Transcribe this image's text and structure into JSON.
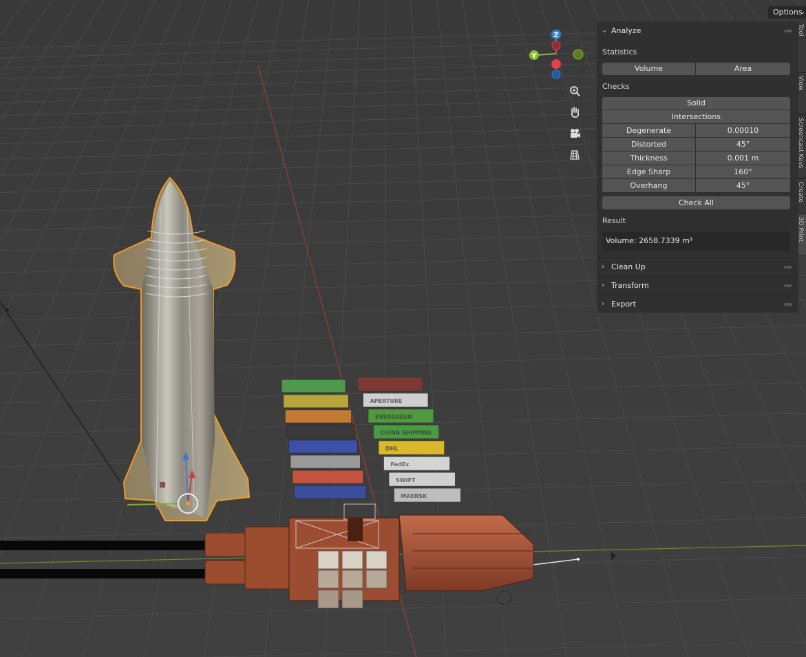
{
  "header": {
    "options_label": "Options"
  },
  "gizmo": {
    "axes": [
      {
        "name": "Z",
        "color": "#2f83e0"
      },
      {
        "name": "Y",
        "color": "#8bbd2a"
      },
      {
        "name": "X",
        "color": "#e0434e"
      }
    ],
    "tools": [
      "zoom-icon",
      "hand-pan-icon",
      "camera-icon",
      "grid-ortho-icon"
    ]
  },
  "panel": {
    "analyze": {
      "title": "Analyze",
      "statistics_label": "Statistics",
      "volume_btn": "Volume",
      "area_btn": "Area",
      "checks_label": "Checks",
      "solid_btn": "Solid",
      "intersections_btn": "Intersections",
      "checks": [
        {
          "label": "Degenerate",
          "value": "0.00010"
        },
        {
          "label": "Distorted",
          "value": "45°"
        },
        {
          "label": "Thickness",
          "value": "0.001 m"
        },
        {
          "label": "Edge Sharp",
          "value": "160°"
        },
        {
          "label": "Overhang",
          "value": "45°"
        }
      ],
      "check_all_btn": "Check All",
      "result_label": "Result",
      "result_value": "Volume: 2658.7339 m³"
    },
    "collapsed_sections": [
      {
        "title": "Clean Up"
      },
      {
        "title": "Transform"
      },
      {
        "title": "Export"
      }
    ]
  },
  "side_tabs": [
    "Tool",
    "View",
    "Screencast Keys",
    "Create",
    "3D Print"
  ],
  "scene": {
    "containers_left": [
      "#4f9a4a",
      "#b7a53a",
      "#c57a34",
      "#3a3a3a",
      "#3e4fa8",
      "#9a9a9a",
      "#c1533f",
      "#3b4d9d"
    ],
    "containers_right": [
      {
        "color": "#7a3a32",
        "brand": ""
      },
      {
        "color": "#cfcfcf",
        "brand": "APERTURE"
      },
      {
        "color": "#4f9a3f",
        "brand": "EVERGREEN"
      },
      {
        "color": "#4a9a44",
        "brand": "CHINA SHIPPING"
      },
      {
        "color": "#d9b82c",
        "brand": "DHL"
      },
      {
        "color": "#d4d4d4",
        "brand": "FedEx"
      },
      {
        "color": "#cfcfcf",
        "brand": "SWIFT"
      },
      {
        "color": "#bdbdbd",
        "brand": "MAERSK"
      }
    ]
  }
}
